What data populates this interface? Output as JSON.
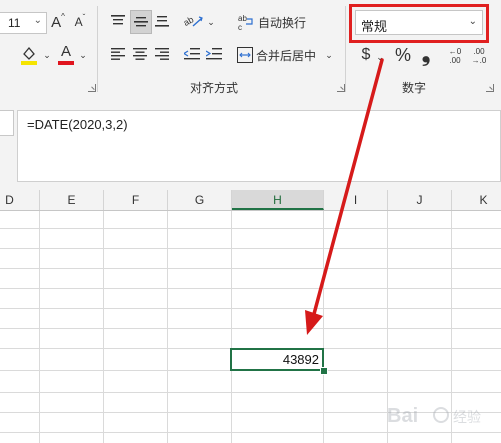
{
  "ribbon": {
    "font_size": "11",
    "wrap_text_label": "自动换行",
    "merge_center_label": "合并后居中",
    "alignment_group_label": "对齐方式",
    "number_group_label": "数字",
    "number_format_value": "常规",
    "font_color_letter": "A",
    "grow_font_letter": "A",
    "shrink_font_letter": "A",
    "currency_symbol": "$",
    "percent_symbol": "%",
    "comma_symbol": "❟",
    "dec_increase_top": "←0",
    "dec_increase_bottom": ".00",
    "dec_decrease_top": ".00",
    "dec_decrease_bottom": "→.0",
    "accent_red": "#e02020",
    "accent_green": "#217346"
  },
  "formula_bar": {
    "formula": "=DATE(2020,3,2)"
  },
  "sheet": {
    "columns": [
      "D",
      "E",
      "F",
      "G",
      "H",
      "I",
      "J",
      "K"
    ],
    "active_column": "H",
    "active_cell_value": "43892"
  },
  "watermark": {
    "text": "Bai 经验"
  }
}
